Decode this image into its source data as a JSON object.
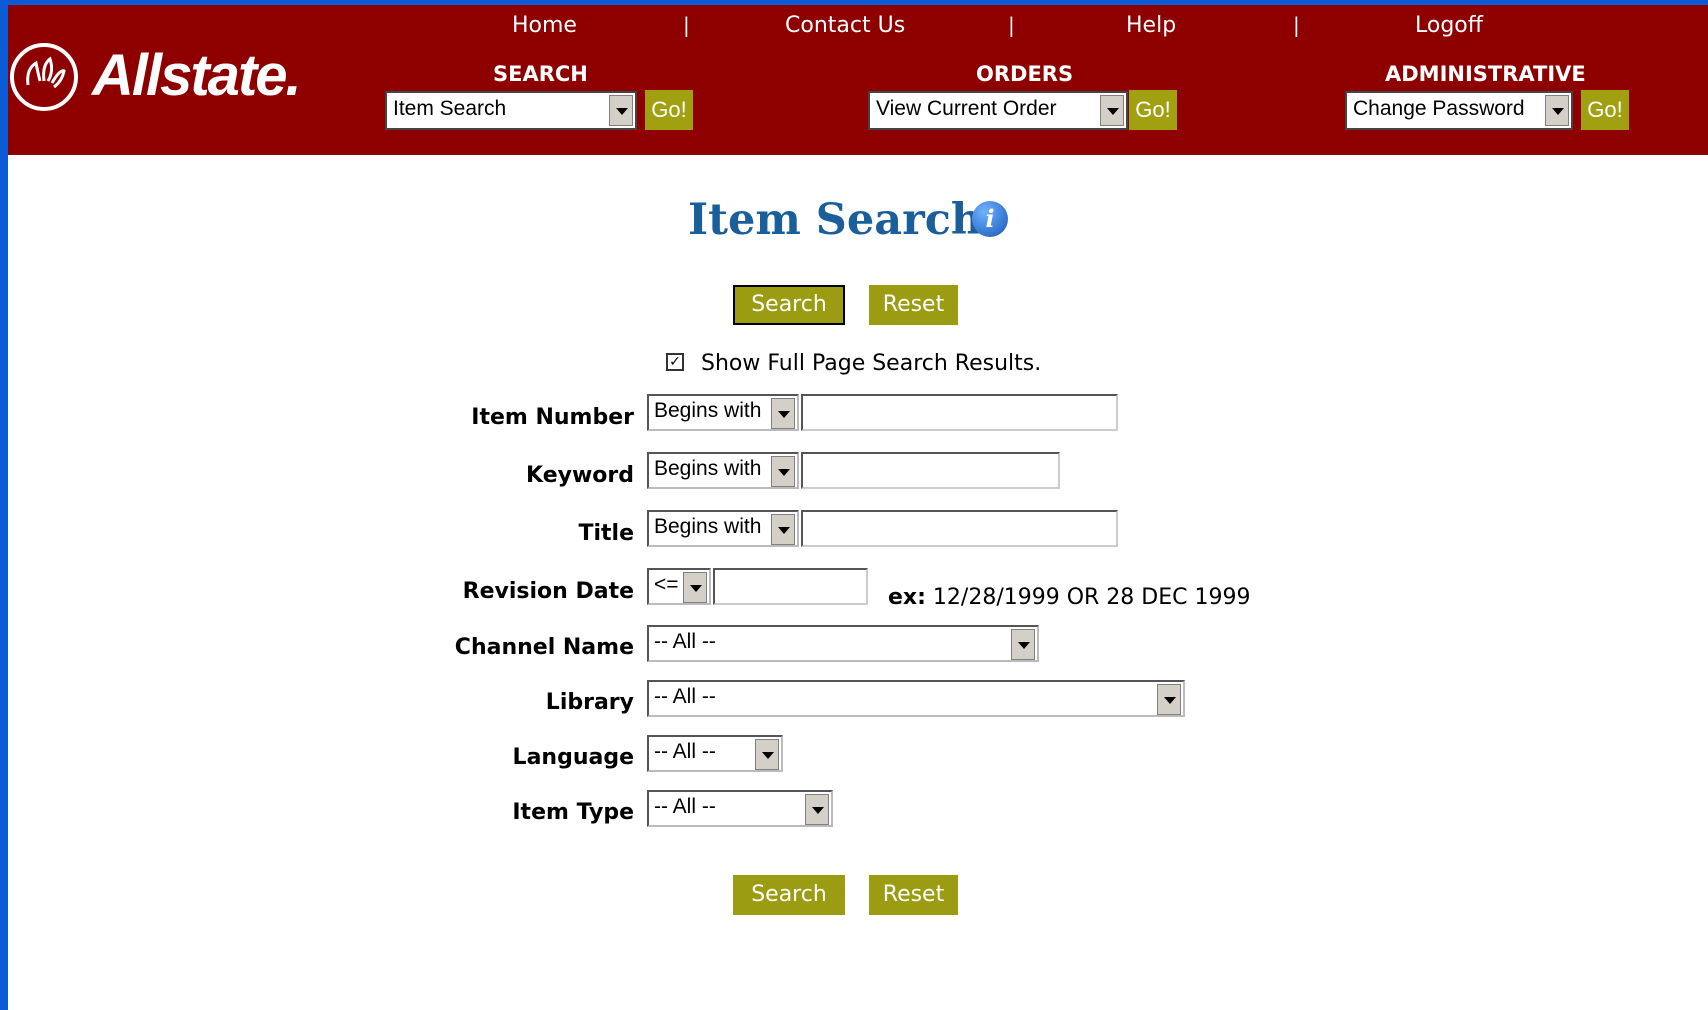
{
  "colors": {
    "header_bg": "#8e0000",
    "button_bg": "#9c9c12",
    "title": "#1a5e9a",
    "window_border": "#0b5bd6"
  },
  "nav": {
    "home": "Home",
    "contact": "Contact Us",
    "help": "Help",
    "logoff": "Logoff",
    "separator": "|"
  },
  "logo": {
    "text": "Allstate."
  },
  "menus": {
    "search": {
      "title": "SEARCH",
      "selected": "Item Search",
      "go": "Go!"
    },
    "orders": {
      "title": "ORDERS",
      "selected": "View Current Order",
      "go": "Go!"
    },
    "admin": {
      "title": "ADMINISTRATIVE",
      "selected": "Change Password",
      "go": "Go!"
    }
  },
  "page": {
    "title": "Item Search",
    "info_icon": "info-icon"
  },
  "buttons": {
    "search": "Search",
    "reset": "Reset"
  },
  "full_page": {
    "label": "Show Full Page Search Results.",
    "checked": true,
    "mark": "✓"
  },
  "form": {
    "item_number": {
      "label": "Item Number",
      "operator": "Begins with",
      "value": ""
    },
    "keyword": {
      "label": "Keyword",
      "operator": "Begins with",
      "value": ""
    },
    "title": {
      "label": "Title",
      "operator": "Begins with",
      "value": ""
    },
    "revision_date": {
      "label": "Revision Date",
      "operator": "<=",
      "value": "",
      "example_label": "ex:",
      "example_text": "12/28/1999 OR 28 DEC 1999"
    },
    "channel_name": {
      "label": "Channel Name",
      "selected": "-- All --"
    },
    "library": {
      "label": "Library",
      "selected": "-- All --"
    },
    "language": {
      "label": "Language",
      "selected": "-- All --"
    },
    "item_type": {
      "label": "Item Type",
      "selected": "-- All --"
    }
  }
}
